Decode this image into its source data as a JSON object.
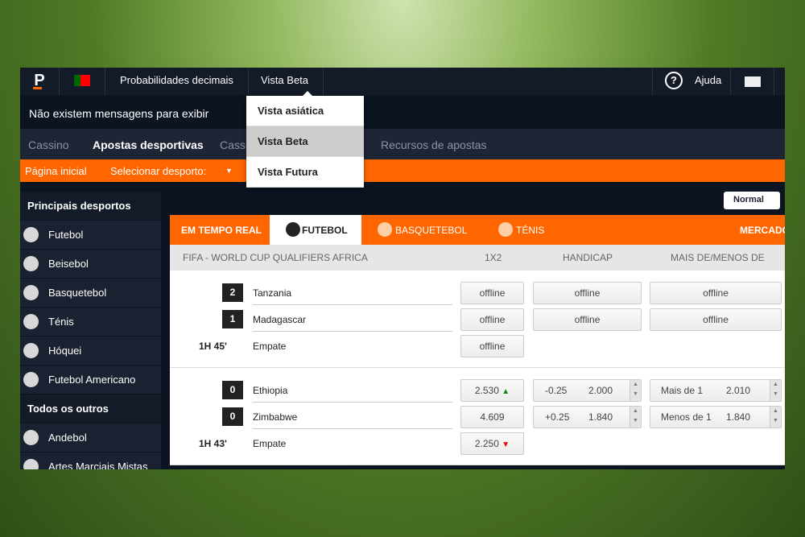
{
  "topbar": {
    "logo": "P",
    "odds_format": "Probabilidades decimais",
    "view": "Vista Beta",
    "help": "Ajuda"
  },
  "view_menu": {
    "items": [
      "Vista asiática",
      "Vista Beta",
      "Vista Futura"
    ],
    "selected": "Vista Beta"
  },
  "messages": "Não existem mensagens para exibir",
  "nav": {
    "items": [
      "Cassino",
      "Apostas desportivas",
      "Cassi",
      "Recursos de apostas"
    ],
    "active": "Apostas desportivas"
  },
  "breadcrumb": {
    "home": "Página inicial",
    "select": "Selecionar desporto:"
  },
  "sidebar": {
    "top_header": "Principais desportos",
    "top": [
      "Futebol",
      "Beisebol",
      "Basquetebol",
      "Ténis",
      "Hóquei",
      "Futebol Americano"
    ],
    "other_header": "Todos os outros desportos",
    "other": [
      "Andebol",
      "Artes Marciais Mistas"
    ]
  },
  "toolbar": {
    "mode": "Normal"
  },
  "sport_tabs": {
    "live": "EM TEMPO REAL",
    "tabs": [
      "FUTEBOL",
      "BASQUETEBOL",
      "TÉNIS"
    ],
    "active": "FUTEBOL",
    "markets": "MERCADOS"
  },
  "table": {
    "league": "FIFA - WORLD CUP QUALIFIERS AFRICA",
    "cols": [
      "1X2",
      "HANDICAP",
      "MAIS DE/MENOS DE"
    ]
  },
  "matches": [
    {
      "home": {
        "score": "2",
        "name": "Tanzania"
      },
      "away": {
        "score": "1",
        "name": "Madagascar"
      },
      "draw": "Empate",
      "clock": "1H 45'",
      "x12": [
        "offline",
        "offline",
        "offline"
      ],
      "handicap": [
        {
          "line": "",
          "odds": "offline"
        },
        {
          "line": "",
          "odds": "offline"
        }
      ],
      "ou": [
        {
          "line": "",
          "odds": "offline"
        },
        {
          "line": "",
          "odds": "offline"
        }
      ]
    },
    {
      "home": {
        "score": "0",
        "name": "Ethiopia"
      },
      "away": {
        "score": "0",
        "name": "Zimbabwe"
      },
      "draw": "Empate",
      "clock": "1H 43'",
      "x12": [
        "2.530",
        "4.609",
        "2.250"
      ],
      "x12_trend": [
        "up",
        "",
        "down"
      ],
      "handicap": [
        {
          "line": "-0.25",
          "odds": "2.000"
        },
        {
          "line": "+0.25",
          "odds": "1.840"
        }
      ],
      "ou": [
        {
          "line": "Mais de 1",
          "odds": "2.010"
        },
        {
          "line": "Menos de 1",
          "odds": "1.840"
        }
      ]
    }
  ],
  "colors": {
    "brand": "#ff6600",
    "dark": "#0c1421",
    "up": "#118811",
    "down": "#e00000"
  }
}
